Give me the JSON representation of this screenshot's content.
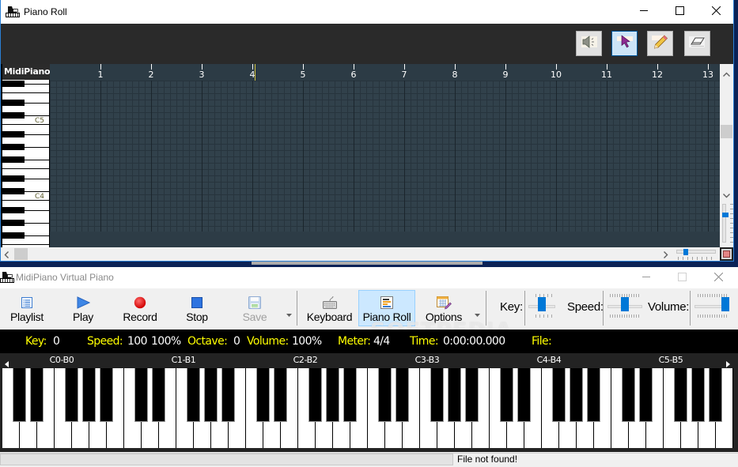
{
  "piano_roll": {
    "title": "Piano Roll",
    "app_icon": "piano-app-icon",
    "window_controls": [
      "minimize-icon",
      "maximize-icon",
      "close-icon"
    ],
    "tools": [
      {
        "id": "mute",
        "icon": "speaker-mute-icon",
        "selected": false
      },
      {
        "id": "select",
        "icon": "pointer-arrow-icon",
        "selected": true
      },
      {
        "id": "draw",
        "icon": "pencil-icon",
        "selected": false
      },
      {
        "id": "erase",
        "icon": "eraser-icon",
        "selected": false
      }
    ],
    "keyboard": {
      "header": "MidiPiano",
      "octave_labels": [
        "C5",
        "C4"
      ]
    },
    "ruler": {
      "measures": [
        "1",
        "2",
        "3",
        "4",
        "5",
        "6",
        "7",
        "8",
        "9",
        "10",
        "11",
        "12",
        "13"
      ],
      "playhead_position": 4.05
    },
    "scroll": {
      "vertical": 0.47,
      "horizontal": 0.0
    },
    "zoom_sliders": {
      "horizontal": 0.2,
      "vertical": 0.25
    },
    "scroll_arrows": {
      "up": "chevron-up-icon",
      "down": "chevron-down-icon",
      "left": "chevron-left-icon",
      "right": "chevron-right-icon"
    }
  },
  "virtual_piano": {
    "title": "MidiPiano Virtual Piano",
    "toolbar": {
      "transport": [
        {
          "label": "Playlist",
          "icon": "playlist-icon",
          "enabled": true
        },
        {
          "label": "Play",
          "icon": "play-icon",
          "enabled": true
        },
        {
          "label": "Record",
          "icon": "record-icon",
          "enabled": true
        },
        {
          "label": "Stop",
          "icon": "stop-icon",
          "enabled": true
        },
        {
          "label": "Save",
          "icon": "save-icon",
          "enabled": false
        }
      ],
      "views": [
        {
          "label": "Keyboard",
          "icon": "keyboard-icon",
          "active": false
        },
        {
          "label": "Piano Roll",
          "icon": "piano-roll-icon",
          "active": true
        },
        {
          "label": "Options",
          "icon": "options-icon",
          "active": false
        }
      ],
      "sliders": [
        {
          "label": "Key:",
          "value": 0.5
        },
        {
          "label": "Speed:",
          "value": 0.5
        },
        {
          "label": "Volume:",
          "value": 1.0
        }
      ]
    },
    "info_bar": {
      "key_label": "Key:",
      "key_value": "0",
      "speed_label": "Speed:",
      "speed_value": "100",
      "speed_percent": "100%",
      "octave_label": "Octave:",
      "octave_value": "0",
      "volume_label": "Volume:",
      "volume_value": "100%",
      "meter_label": "Meter:",
      "meter_value": "4/4",
      "time_label": "Time:",
      "time_value": "0:00:00.000",
      "file_label": "File:",
      "file_value": ""
    },
    "keyboard": {
      "octave_ranges": [
        "C0-B0",
        "C1-B1",
        "C2-B2",
        "C3-B3",
        "C4-B4",
        "C5-B5"
      ],
      "scroll_left_icon": "triangle-left-icon",
      "scroll_right_icon": "triangle-right-icon"
    },
    "status_bar": {
      "left": "",
      "message": "File not found!"
    }
  },
  "colors": {
    "accent": "#0078d7",
    "selected_tool_bg": "#cce4f7",
    "grid": "#31414b",
    "playhead": "#d6c43e",
    "info_label": "#ffff00",
    "info_value": "#ffffff",
    "record": "#d00000"
  },
  "watermark": "SOFTPEDIA"
}
